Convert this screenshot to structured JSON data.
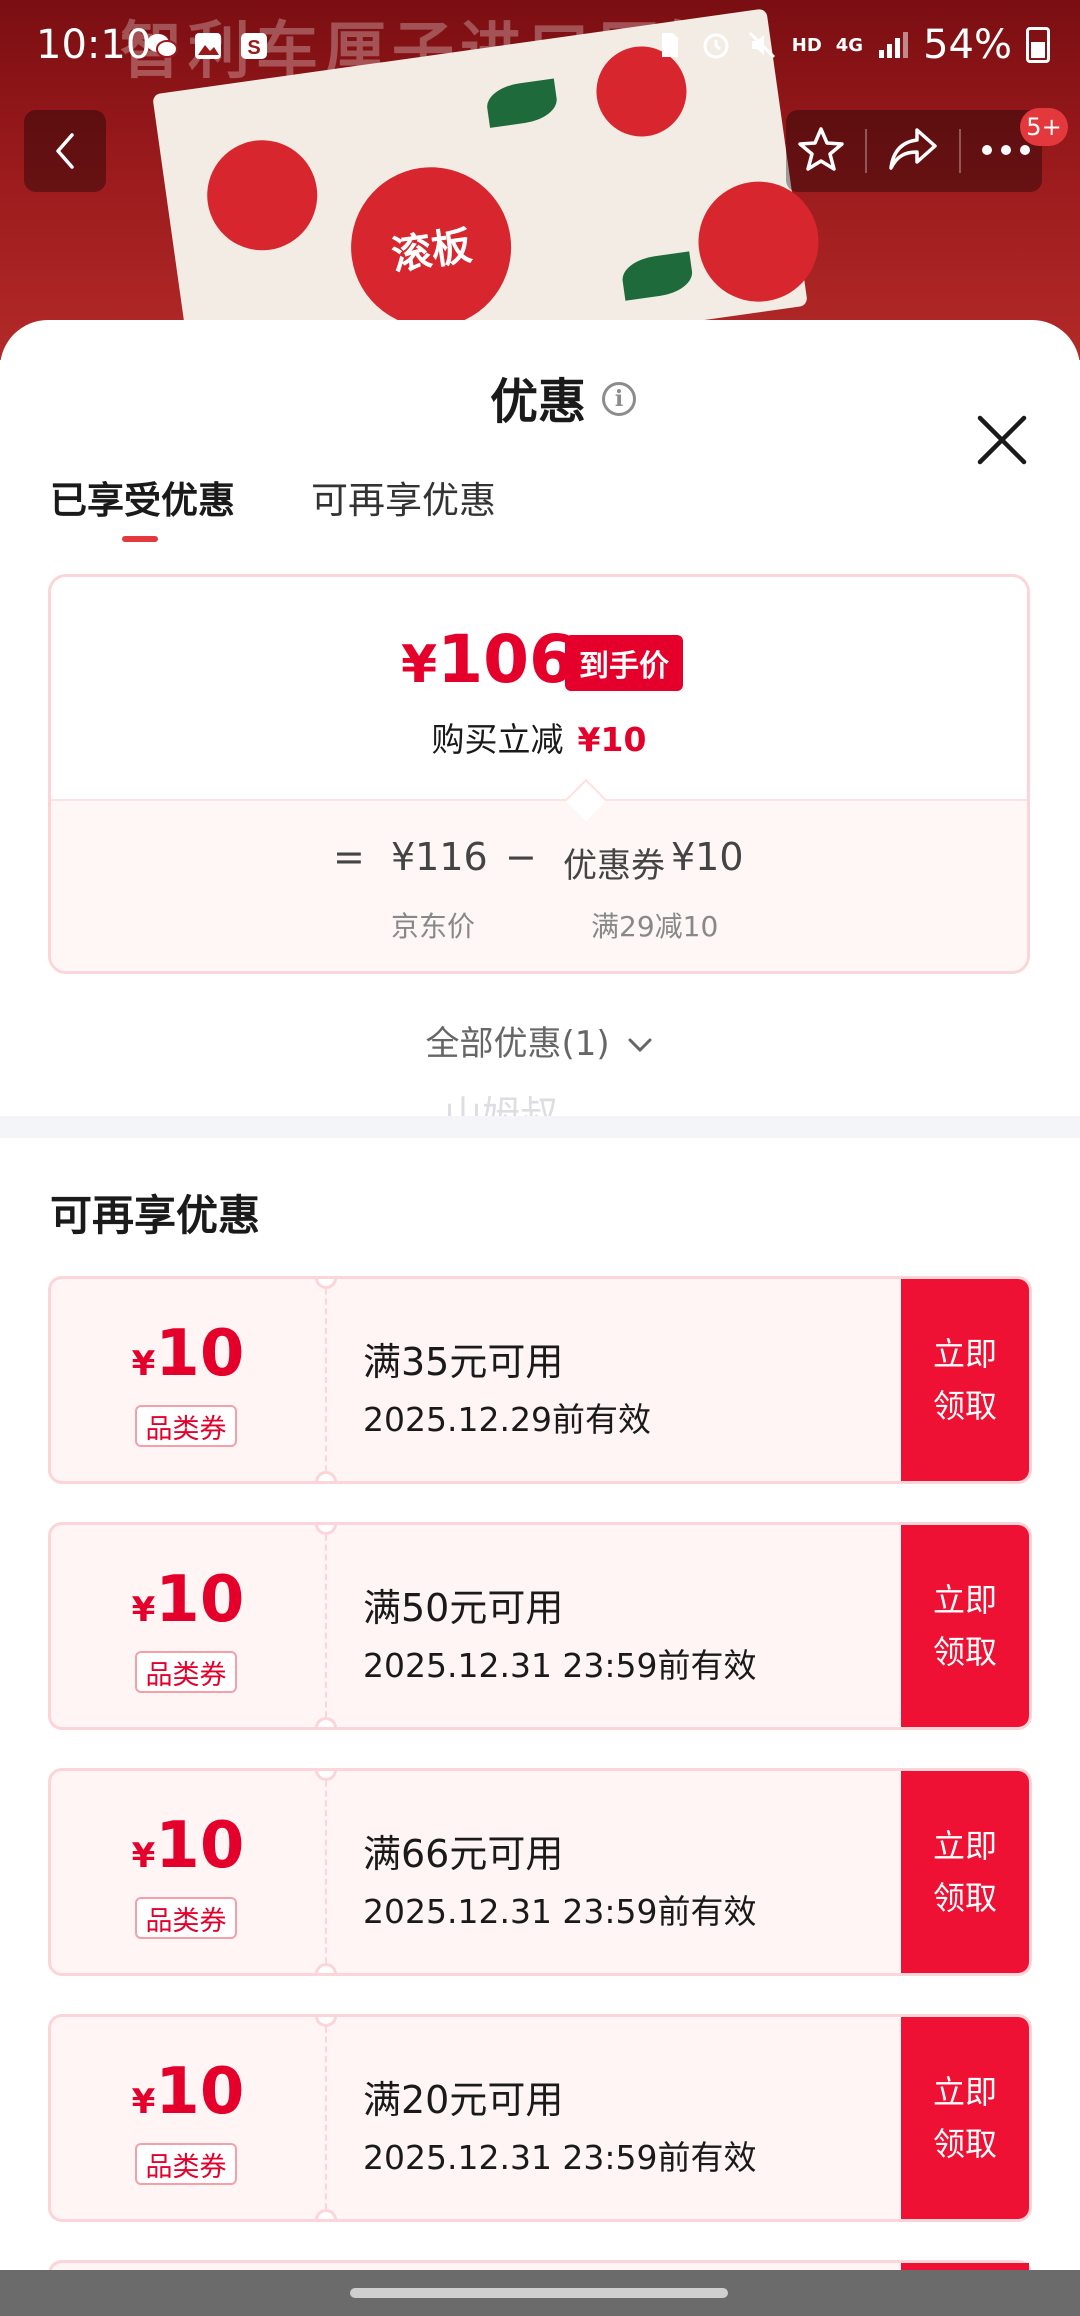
{
  "status_bar": {
    "time": "10:10",
    "network": "4G",
    "hd": "HD",
    "battery": "54%"
  },
  "background": {
    "banner_text": "智利车厘子进口原箱",
    "product_badge": "滚板"
  },
  "top_nav": {
    "message_count": "5+"
  },
  "sheet": {
    "title": "优惠",
    "tabs": [
      {
        "label": "已享受优惠",
        "active": true
      },
      {
        "label": "可再享优惠",
        "active": false
      }
    ],
    "price_card": {
      "final_price_symbol": "¥",
      "final_price": "106",
      "final_price_tag": "到手价",
      "instant_label": "购买立减",
      "instant_amount": "¥10",
      "equation": {
        "equals": "=",
        "base_price": "¥116",
        "minus": "−",
        "discount_label": "优惠券",
        "discount_amount": "¥10"
      },
      "base_price_label": "京东价",
      "discount_desc": "满29减10"
    },
    "all_discount_link": "全部优惠(1)",
    "watermark": "山姆叔",
    "section_title": "可再享优惠",
    "coupons": [
      {
        "symbol": "¥",
        "amount": "10",
        "type": "品类券",
        "condition": "满35元可用",
        "validity": "2025.12.29前有效",
        "button_l1": "立即",
        "button_l2": "领取"
      },
      {
        "symbol": "¥",
        "amount": "10",
        "type": "品类券",
        "condition": "满50元可用",
        "validity": "2025.12.31 23:59前有效",
        "button_l1": "立即",
        "button_l2": "领取"
      },
      {
        "symbol": "¥",
        "amount": "10",
        "type": "品类券",
        "condition": "满66元可用",
        "validity": "2025.12.31 23:59前有效",
        "button_l1": "立即",
        "button_l2": "领取"
      },
      {
        "symbol": "¥",
        "amount": "10",
        "type": "品类券",
        "condition": "满20元可用",
        "validity": "2025.12.31 23:59前有效",
        "button_l1": "立即",
        "button_l2": "领取"
      }
    ]
  },
  "colors": {
    "accent_red": "#e4002b",
    "coupon_border": "#fbd5d8",
    "coupon_bg": "#fff5f5",
    "button_red": "#ee1133"
  }
}
